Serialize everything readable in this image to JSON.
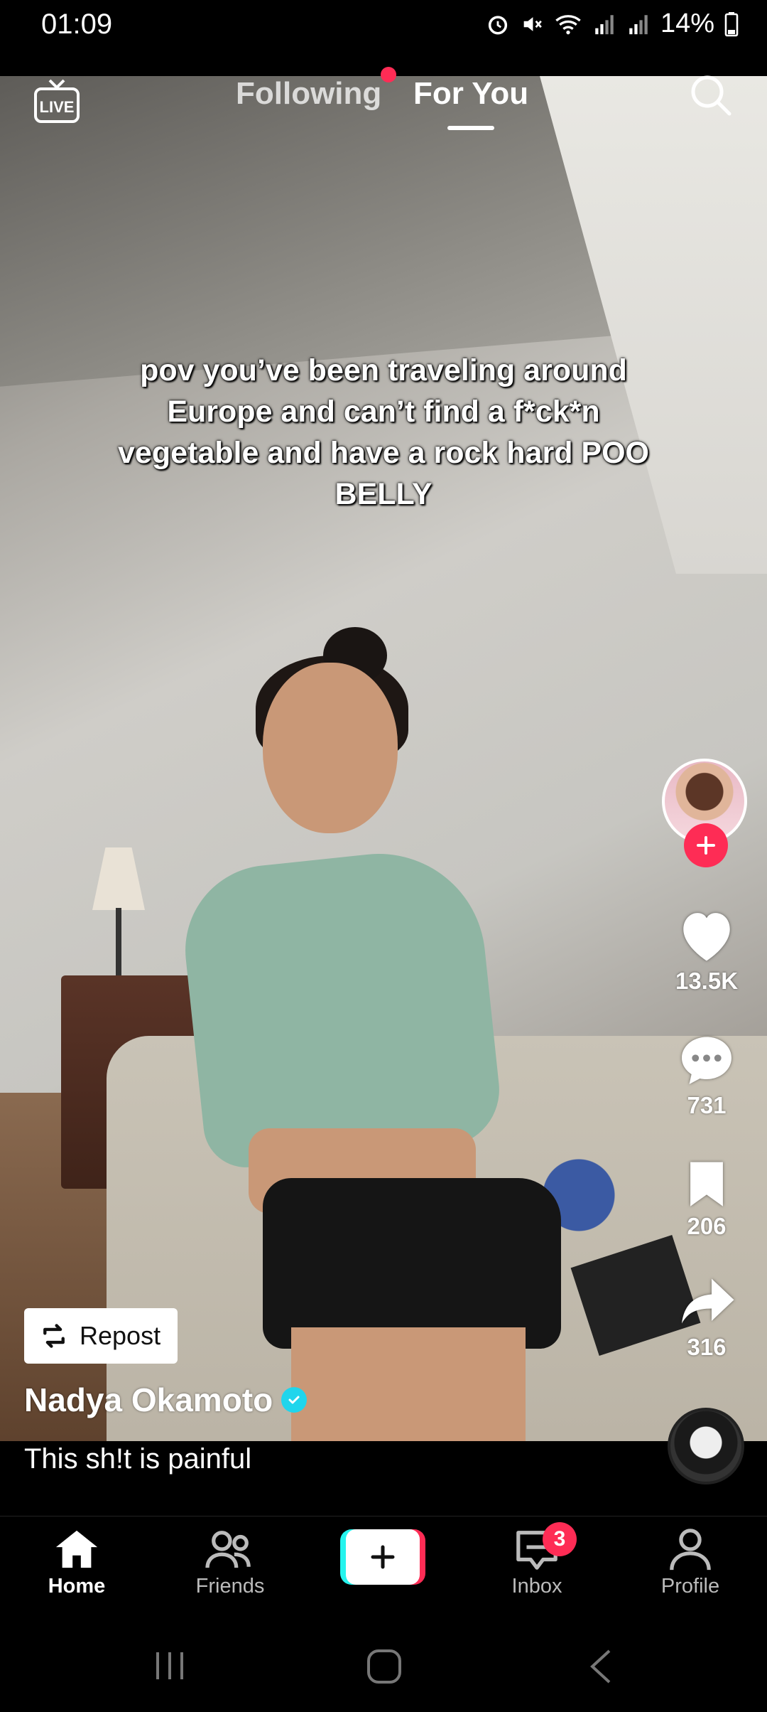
{
  "status_bar": {
    "time": "01:09",
    "battery": "14%"
  },
  "top_nav": {
    "live_label": "LIVE",
    "tab_following": "Following",
    "tab_foryou": "For You"
  },
  "video": {
    "overlay_caption": "pov you’ve been traveling around Europe and can’t find a f*ck*n vegetable and have a rock hard POO BELLY"
  },
  "actions": {
    "likes": "13.5K",
    "comments": "731",
    "saves": "206",
    "shares": "316"
  },
  "post": {
    "repost_label": "Repost",
    "author": "Nadya Okamoto",
    "description": "This sh!t is painful"
  },
  "bottom_nav": {
    "home": "Home",
    "friends": "Friends",
    "inbox": "Inbox",
    "inbox_badge": "3",
    "profile": "Profile"
  },
  "colors": {
    "accent": "#fe2c55",
    "cyan": "#25f4ee",
    "verified": "#20d5ec"
  }
}
